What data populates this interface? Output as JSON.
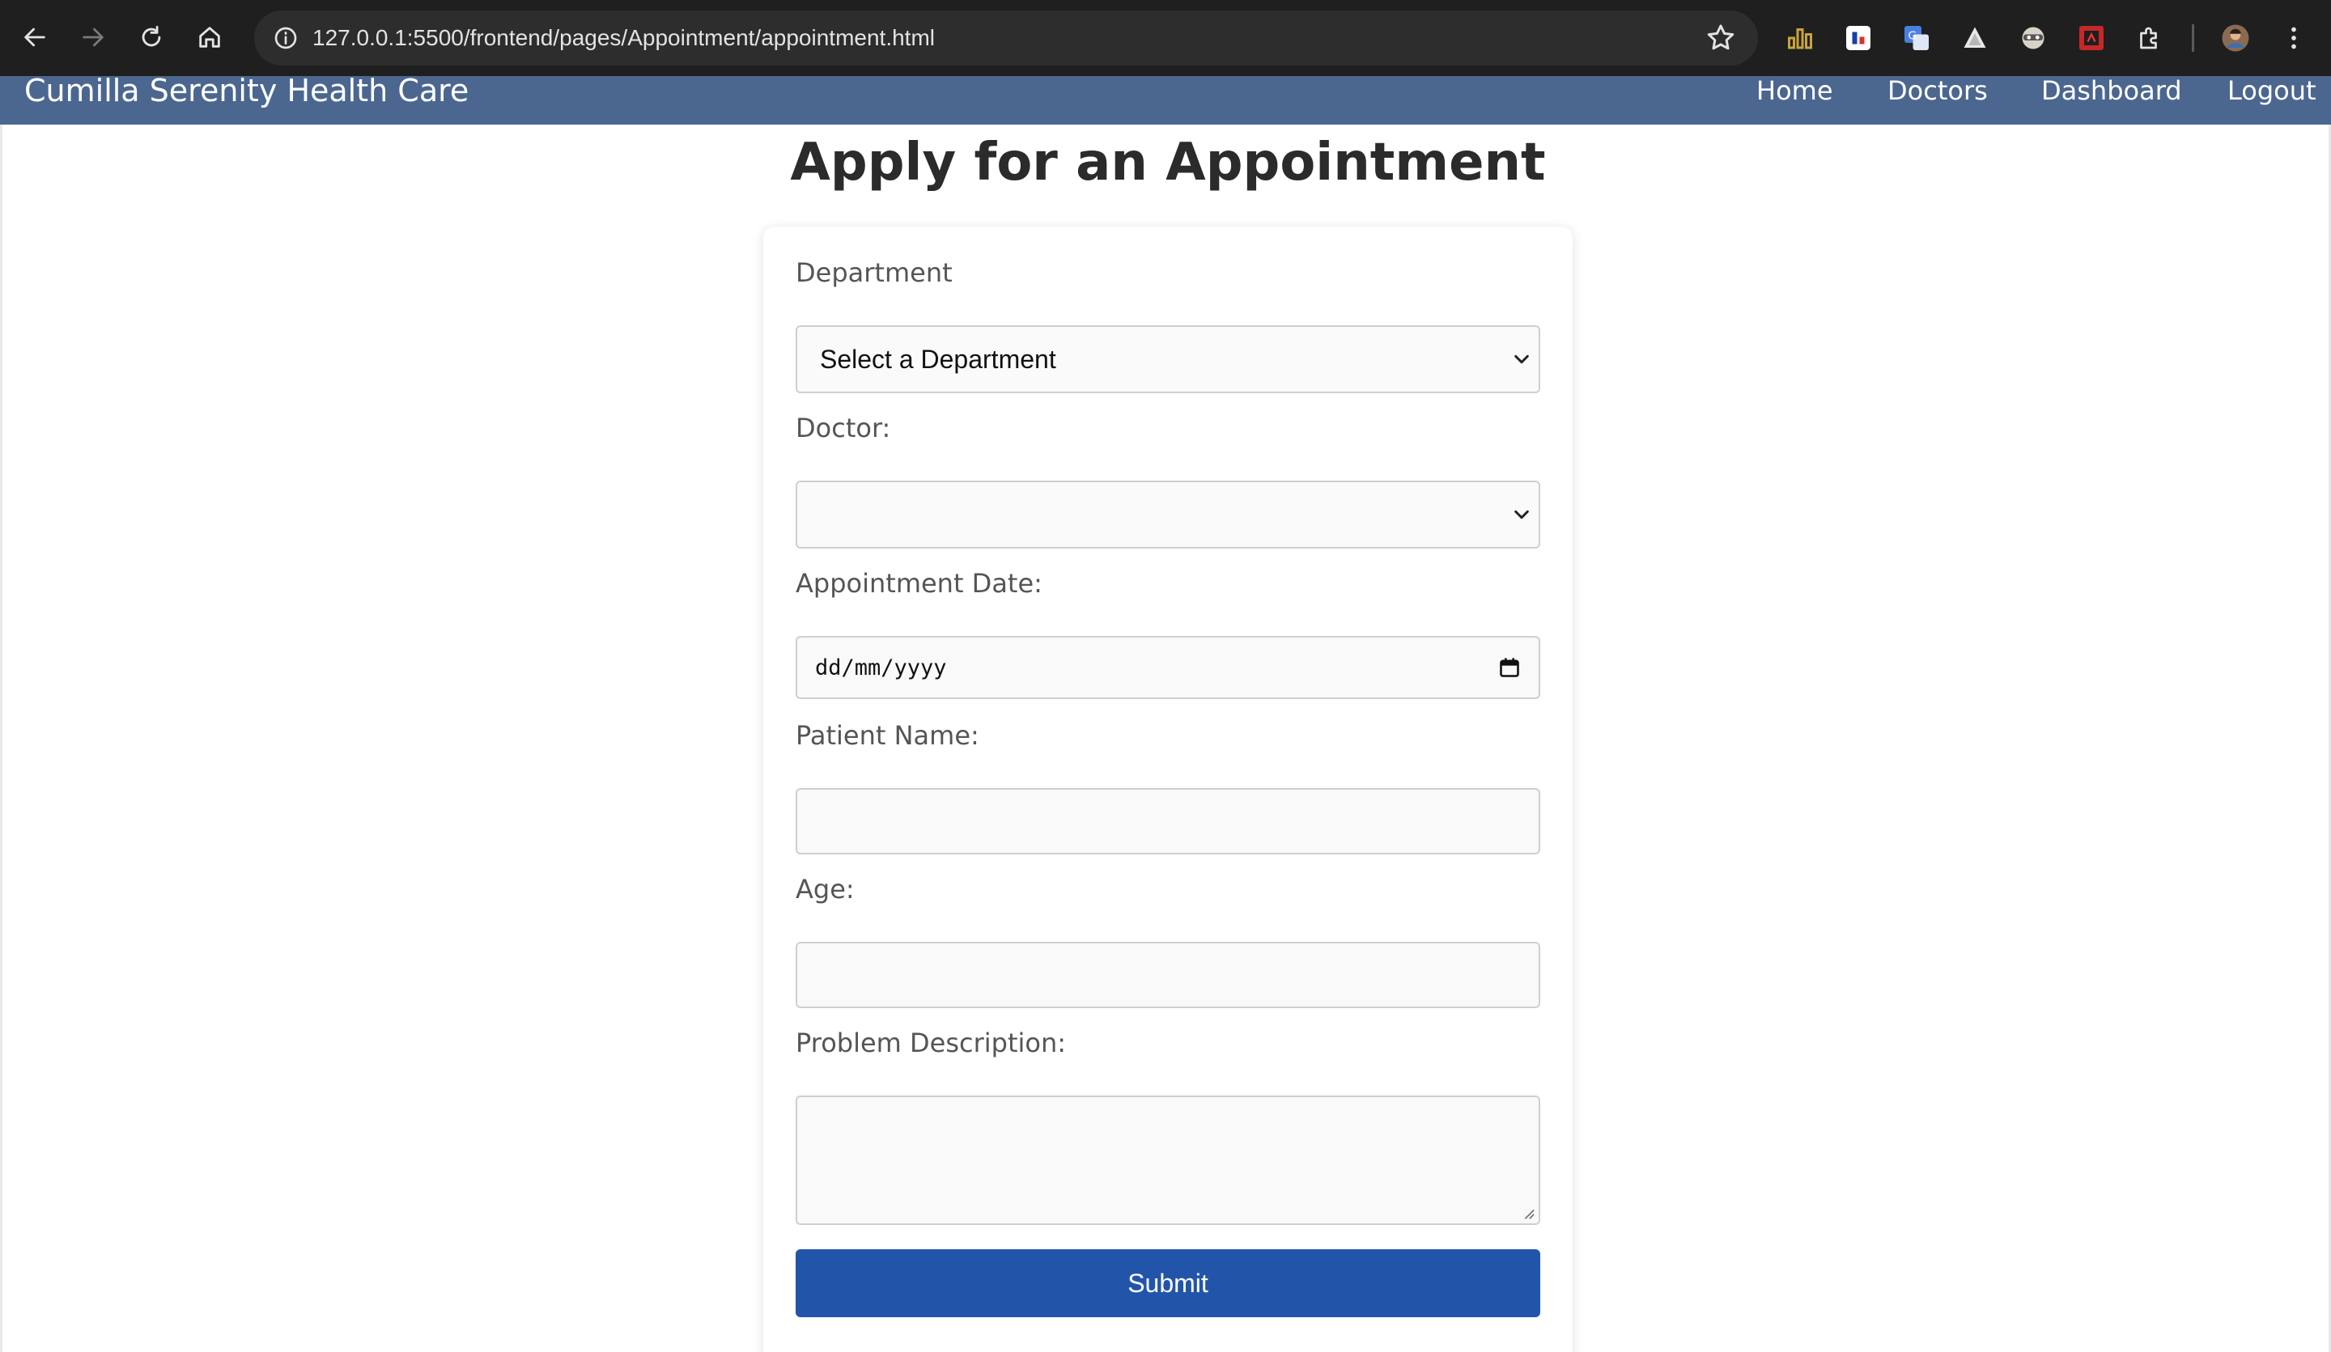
{
  "browser": {
    "url": "127.0.0.1:5500/frontend/pages/Appointment/appointment.html",
    "icons": [
      "back-icon",
      "forward-icon",
      "reload-icon",
      "home-icon",
      "site-info-icon",
      "bookmark-star-icon",
      "extension-chart-icon",
      "extension-flag-icon",
      "extension-translate-icon",
      "extension-triangle-icon",
      "extension-mask-icon",
      "extension-red-icon",
      "extensions-puzzle-icon",
      "profile-avatar",
      "chrome-menu-icon"
    ]
  },
  "nav": {
    "brand": "Cumilla Serenity Health Care",
    "links": [
      "Home",
      "Doctors",
      "Dashboard",
      "Logout"
    ],
    "background": "#4b6790"
  },
  "page": {
    "title": "Apply for an Appointment"
  },
  "form": {
    "department_label": "Department",
    "department_value": "Select a Department",
    "doctor_label": "Doctor:",
    "doctor_value": "",
    "date_label": "Appointment Date:",
    "date_placeholder": "dd/mm/yyyy",
    "patient_label": "Patient Name:",
    "patient_value": "",
    "age_label": "Age:",
    "age_value": "",
    "problem_label": "Problem Description:",
    "problem_value": "",
    "submit_label": "Submit",
    "accent": "#2255aa"
  }
}
